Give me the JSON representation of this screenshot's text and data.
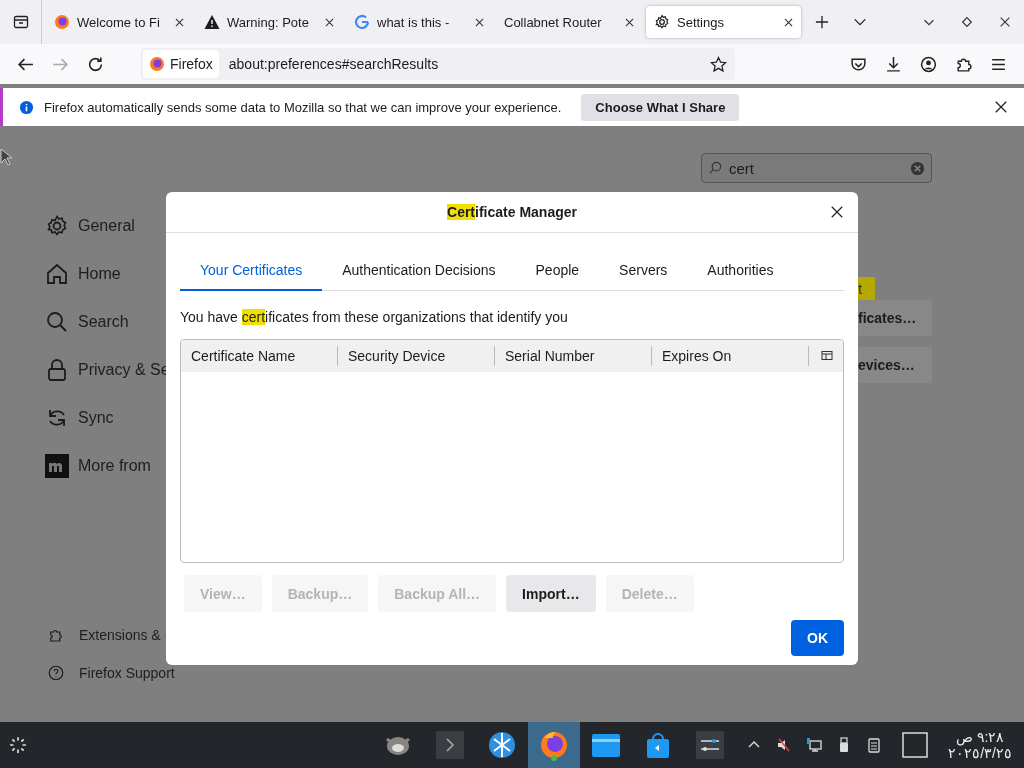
{
  "browser_tabs": [
    {
      "title": "Welcome to Fi",
      "kind": "firefox",
      "selected": false
    },
    {
      "title": "Warning: Pote",
      "kind": "warning",
      "selected": false
    },
    {
      "title": "what is this -",
      "kind": "google",
      "selected": false
    },
    {
      "title": "Collabnet Router",
      "kind": "plain",
      "selected": false
    },
    {
      "title": "Settings",
      "kind": "gear",
      "selected": true
    }
  ],
  "address_bar": {
    "identity": "Firefox",
    "url": "about:preferences#searchResults"
  },
  "notification": {
    "message": "Firefox automatically sends some data to Mozilla so that we can improve your experience.",
    "button": "Choose What I Share"
  },
  "sidebar": {
    "items": [
      {
        "label": "General",
        "kind": "gear"
      },
      {
        "label": "Home",
        "kind": "home"
      },
      {
        "label": "Search",
        "kind": "search"
      },
      {
        "label": "Privacy & Se",
        "kind": "lock"
      },
      {
        "label": "Sync",
        "kind": "sync"
      },
      {
        "label": "More from",
        "kind": "m"
      }
    ],
    "footer": [
      {
        "label": "Extensions &",
        "kind": "puzzle"
      },
      {
        "label": "Firefox Support",
        "kind": "help"
      }
    ]
  },
  "settings_search": {
    "value": "cert"
  },
  "behind_dialog": {
    "highlight": "t",
    "buttons": [
      "ficates…",
      "evices…"
    ]
  },
  "dialog": {
    "title_parts": [
      {
        "text": "Cert",
        "highlighted": true
      },
      {
        "text": "ificate Manager",
        "highlighted": false
      }
    ],
    "tabs": [
      {
        "label": "Your Certificates",
        "selected": true
      },
      {
        "label": "Authentication Decisions",
        "selected": false
      },
      {
        "label": "People",
        "selected": false
      },
      {
        "label": "Servers",
        "selected": false
      },
      {
        "label": "Authorities",
        "selected": false
      }
    ],
    "description_parts": [
      {
        "text": "You have ",
        "highlighted": false
      },
      {
        "text": "cert",
        "highlighted": true
      },
      {
        "text": "ificates from these organizations that identify you",
        "highlighted": false
      }
    ],
    "table": {
      "columns": [
        "Certificate Name",
        "Security Device",
        "Serial Number",
        "Expires On"
      ]
    },
    "buttons": [
      {
        "label": "View…",
        "disabled": true
      },
      {
        "label": "Backup…",
        "disabled": true
      },
      {
        "label": "Backup All…",
        "disabled": true
      },
      {
        "label": "Import…",
        "disabled": false
      },
      {
        "label": "Delete…",
        "disabled": true
      }
    ],
    "ok": "OK"
  },
  "taskbar": {
    "apps": [
      {
        "kind": "gimp",
        "active": false
      },
      {
        "kind": "terminal",
        "active": false
      },
      {
        "kind": "globe",
        "active": false
      },
      {
        "kind": "firefox",
        "active": true
      },
      {
        "kind": "files",
        "active": false
      },
      {
        "kind": "store",
        "active": false
      },
      {
        "kind": "settings",
        "active": false
      }
    ],
    "time": "٩:٢٨ ص",
    "date": "٢٠٢٥/٣/٢٥"
  }
}
